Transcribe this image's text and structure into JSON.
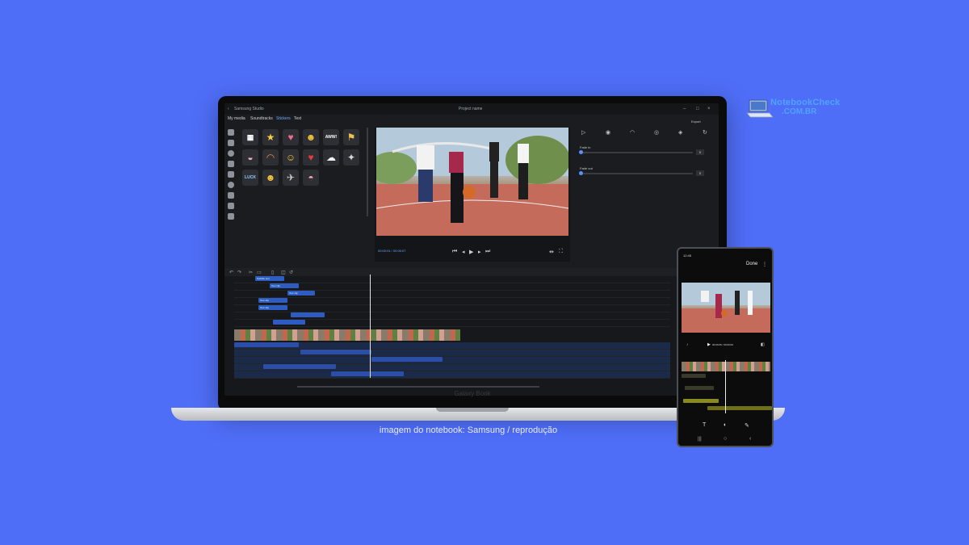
{
  "caption": "imagem do notebook: Samsung / reprodução",
  "watermark": {
    "line1": "NotebookCheck",
    "line2": ".COM.BR"
  },
  "laptop": {
    "brand": "Galaxy Book"
  },
  "app": {
    "window_title": "Samsung Studio",
    "document_title": "Project name",
    "tabs": [
      {
        "label": "My media"
      },
      {
        "label": "Soundtracks"
      },
      {
        "label": "Stickers"
      },
      {
        "label": "Text"
      }
    ],
    "export_label": "Export",
    "timecode": "00:00:01 / 00:00:07",
    "properties": {
      "fade_in_label": "Fade in",
      "fade_in_value": "0",
      "fade_out_label": "Fade out",
      "fade_out_value": "0"
    },
    "timeline_clips": [
      {
        "label": "Subtitle text"
      },
      {
        "label": "Text clip"
      },
      {
        "label": "Text clip"
      },
      {
        "label": "Text clip"
      },
      {
        "label": "Text clip"
      }
    ]
  },
  "phone": {
    "status_time": "12:45",
    "done_label": "Done",
    "timecode": "00:00:05 / 00:00:09"
  },
  "colors": {
    "background": "#4f6ef7",
    "accent": "#5b8fff",
    "clip": "#2f5cc2"
  }
}
